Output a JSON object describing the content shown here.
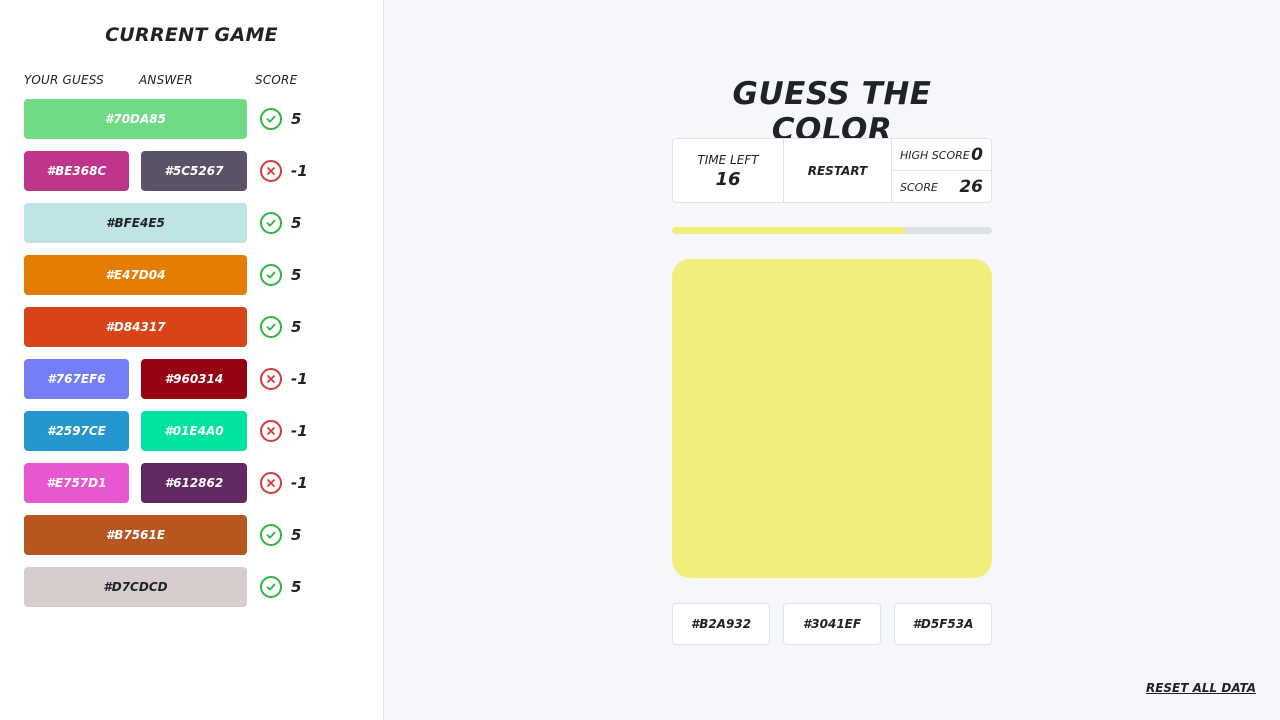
{
  "sidebar": {
    "title": "CURRENT GAME",
    "headers": {
      "guess": "YOUR GUESS",
      "answer": "ANSWER",
      "score": "SCORE"
    },
    "rows": [
      {
        "guess": "#70DA85",
        "guess_color": "#70DA85",
        "answer": null,
        "answer_color": null,
        "correct": true,
        "score": "5",
        "dark_text": false
      },
      {
        "guess": "#BE368C",
        "guess_color": "#BE368C",
        "answer": "#5C5267",
        "answer_color": "#5C5267",
        "correct": false,
        "score": "-1",
        "dark_text": false
      },
      {
        "guess": "#BFE4E5",
        "guess_color": "#BFE4E5",
        "answer": null,
        "answer_color": null,
        "correct": true,
        "score": "5",
        "dark_text": true
      },
      {
        "guess": "#E47D04",
        "guess_color": "#E47D04",
        "answer": null,
        "answer_color": null,
        "correct": true,
        "score": "5",
        "dark_text": false
      },
      {
        "guess": "#D84317",
        "guess_color": "#D84317",
        "answer": null,
        "answer_color": null,
        "correct": true,
        "score": "5",
        "dark_text": false
      },
      {
        "guess": "#767EF6",
        "guess_color": "#767EF6",
        "answer": "#960314",
        "answer_color": "#960314",
        "correct": false,
        "score": "-1",
        "dark_text": false
      },
      {
        "guess": "#2597CE",
        "guess_color": "#2597CE",
        "answer": "#01E4A0",
        "answer_color": "#01E4A0",
        "correct": false,
        "score": "-1",
        "dark_text": false
      },
      {
        "guess": "#E757D1",
        "guess_color": "#E757D1",
        "answer": "#612862",
        "answer_color": "#612862",
        "correct": false,
        "score": "-1",
        "dark_text": false
      },
      {
        "guess": "#B7561E",
        "guess_color": "#B7561E",
        "answer": null,
        "answer_color": null,
        "correct": true,
        "score": "5",
        "dark_text": false
      },
      {
        "guess": "#D7CDCD",
        "guess_color": "#D7CDCD",
        "answer": null,
        "answer_color": null,
        "correct": true,
        "score": "5",
        "dark_text": true
      }
    ]
  },
  "game": {
    "title": "GUESS THE COLOR",
    "time_left_label": "TIME LEFT",
    "time_left": "16",
    "restart_label": "RESTART",
    "high_score_label": "HIGH SCORE",
    "high_score": "0",
    "score_label": "SCORE",
    "score": "26",
    "progress_fraction": 0.73,
    "target_color": "#F1EF7B",
    "options": [
      "#B2A932",
      "#3041EF",
      "#D5F53A"
    ]
  },
  "reset_label": "RESET ALL DATA",
  "colors": {
    "ok": "#2FB344",
    "bad": "#D63939"
  },
  "icons": {
    "correct": "check-circle-icon",
    "wrong": "x-circle-icon"
  }
}
